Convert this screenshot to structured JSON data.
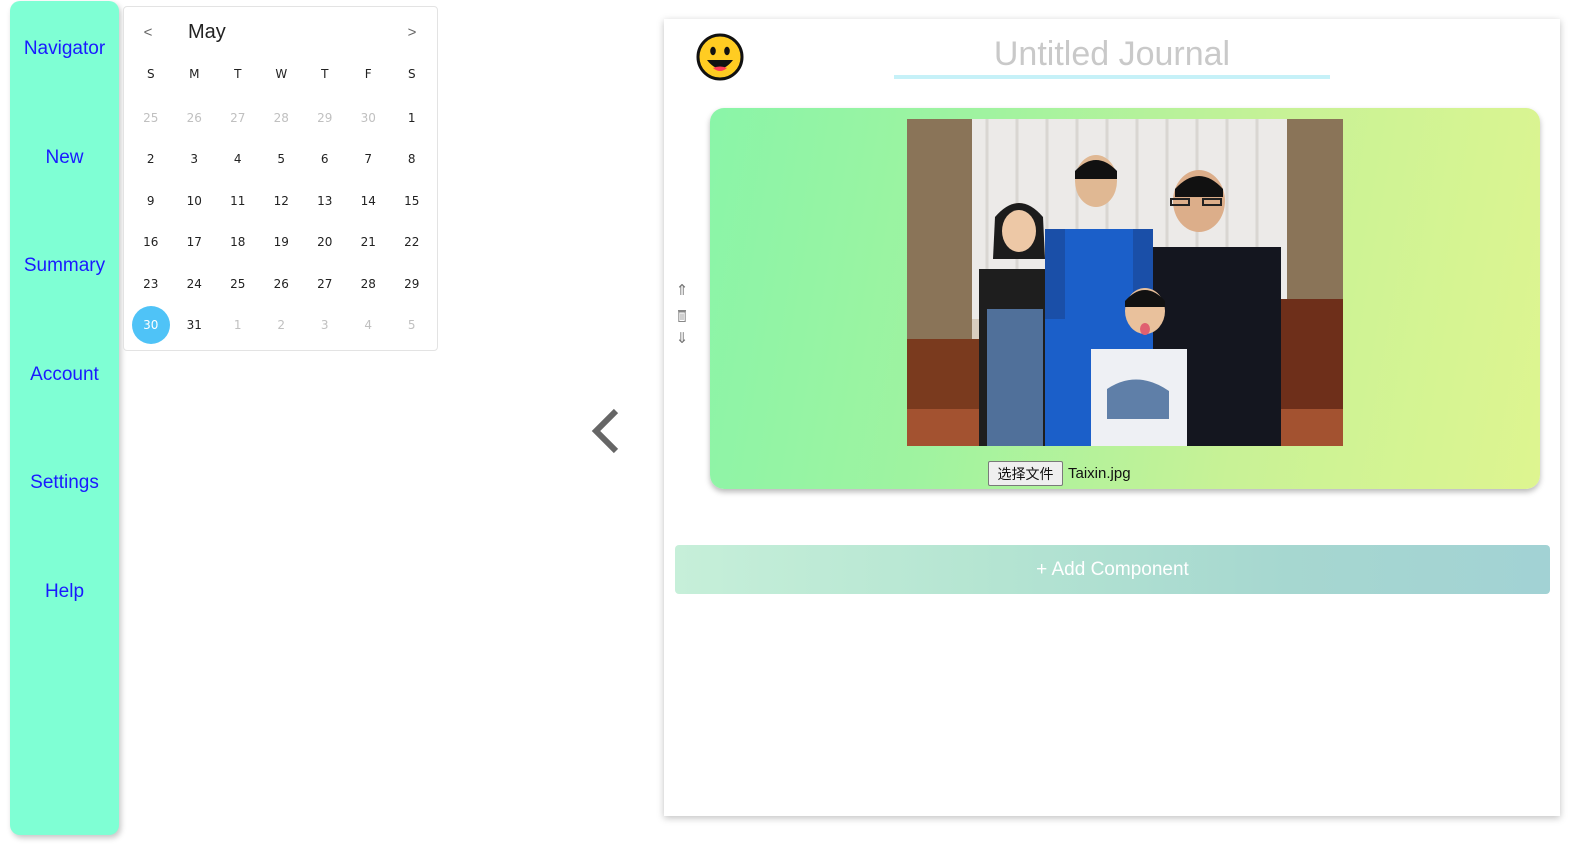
{
  "sidebar": {
    "items": [
      {
        "label": "Navigator"
      },
      {
        "label": "New"
      },
      {
        "label": "Summary"
      },
      {
        "label": "Account"
      },
      {
        "label": "Settings"
      },
      {
        "label": "Help"
      }
    ]
  },
  "calendar": {
    "month": "May",
    "prev_label": "<",
    "next_label": ">",
    "weekdays": [
      "S",
      "M",
      "T",
      "W",
      "T",
      "F",
      "S"
    ],
    "selected_day": "30",
    "days": [
      {
        "d": "25",
        "muted": true
      },
      {
        "d": "26",
        "muted": true
      },
      {
        "d": "27",
        "muted": true
      },
      {
        "d": "28",
        "muted": true
      },
      {
        "d": "29",
        "muted": true
      },
      {
        "d": "30",
        "muted": true
      },
      {
        "d": "1",
        "muted": false
      },
      {
        "d": "2",
        "muted": false
      },
      {
        "d": "3",
        "muted": false
      },
      {
        "d": "4",
        "muted": false
      },
      {
        "d": "5",
        "muted": false
      },
      {
        "d": "6",
        "muted": false
      },
      {
        "d": "7",
        "muted": false
      },
      {
        "d": "8",
        "muted": false
      },
      {
        "d": "9",
        "muted": false
      },
      {
        "d": "10",
        "muted": false
      },
      {
        "d": "11",
        "muted": false
      },
      {
        "d": "12",
        "muted": false
      },
      {
        "d": "13",
        "muted": false
      },
      {
        "d": "14",
        "muted": false
      },
      {
        "d": "15",
        "muted": false
      },
      {
        "d": "16",
        "muted": false
      },
      {
        "d": "17",
        "muted": false
      },
      {
        "d": "18",
        "muted": false
      },
      {
        "d": "19",
        "muted": false
      },
      {
        "d": "20",
        "muted": false
      },
      {
        "d": "21",
        "muted": false
      },
      {
        "d": "22",
        "muted": false
      },
      {
        "d": "23",
        "muted": false
      },
      {
        "d": "24",
        "muted": false
      },
      {
        "d": "25",
        "muted": false
      },
      {
        "d": "26",
        "muted": false
      },
      {
        "d": "27",
        "muted": false
      },
      {
        "d": "28",
        "muted": false
      },
      {
        "d": "29",
        "muted": false
      },
      {
        "d": "30",
        "muted": false,
        "selected": true
      },
      {
        "d": "31",
        "muted": false
      },
      {
        "d": "1",
        "muted": true
      },
      {
        "d": "2",
        "muted": true
      },
      {
        "d": "3",
        "muted": true
      },
      {
        "d": "4",
        "muted": true
      },
      {
        "d": "5",
        "muted": true
      }
    ]
  },
  "collapse": {
    "icon": "chevron-left-icon"
  },
  "journal": {
    "mood_icon": "smiley-face-icon",
    "title_placeholder": "Untitled Journal",
    "title_value": "",
    "controls": {
      "move_up_icon": "arrow-up-icon",
      "delete_icon": "trash-icon",
      "move_down_icon": "arrow-down-icon"
    },
    "image_component": {
      "choose_file_label": "选择文件",
      "file_name": "Taixin.jpg"
    },
    "add_component_label": "+ Add Component"
  },
  "colors": {
    "sidebar_bg": "#7fffd4",
    "nav_text": "#1a1aff",
    "selected_day": "#4fc3f7",
    "title_underline": "#c6f1f8"
  }
}
